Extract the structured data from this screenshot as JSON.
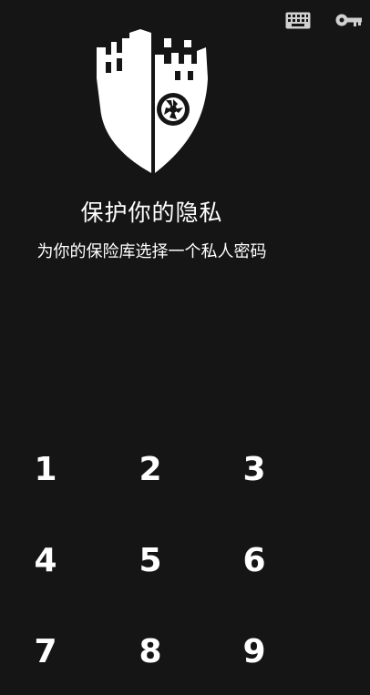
{
  "header": {
    "keyboard_icon": "keyboard-icon",
    "key_icon": "key-icon"
  },
  "logo": {
    "icon": "shield-castle-camera-logo"
  },
  "title": "保护你的隐私",
  "subtitle": "为你的保险库选择一个私人密码",
  "keypad": {
    "keys": [
      "1",
      "2",
      "3",
      "4",
      "5",
      "6",
      "7",
      "8",
      "9"
    ]
  },
  "colors": {
    "background": "#151515",
    "foreground": "#ffffff",
    "icon_gray": "#d0d0d0"
  }
}
